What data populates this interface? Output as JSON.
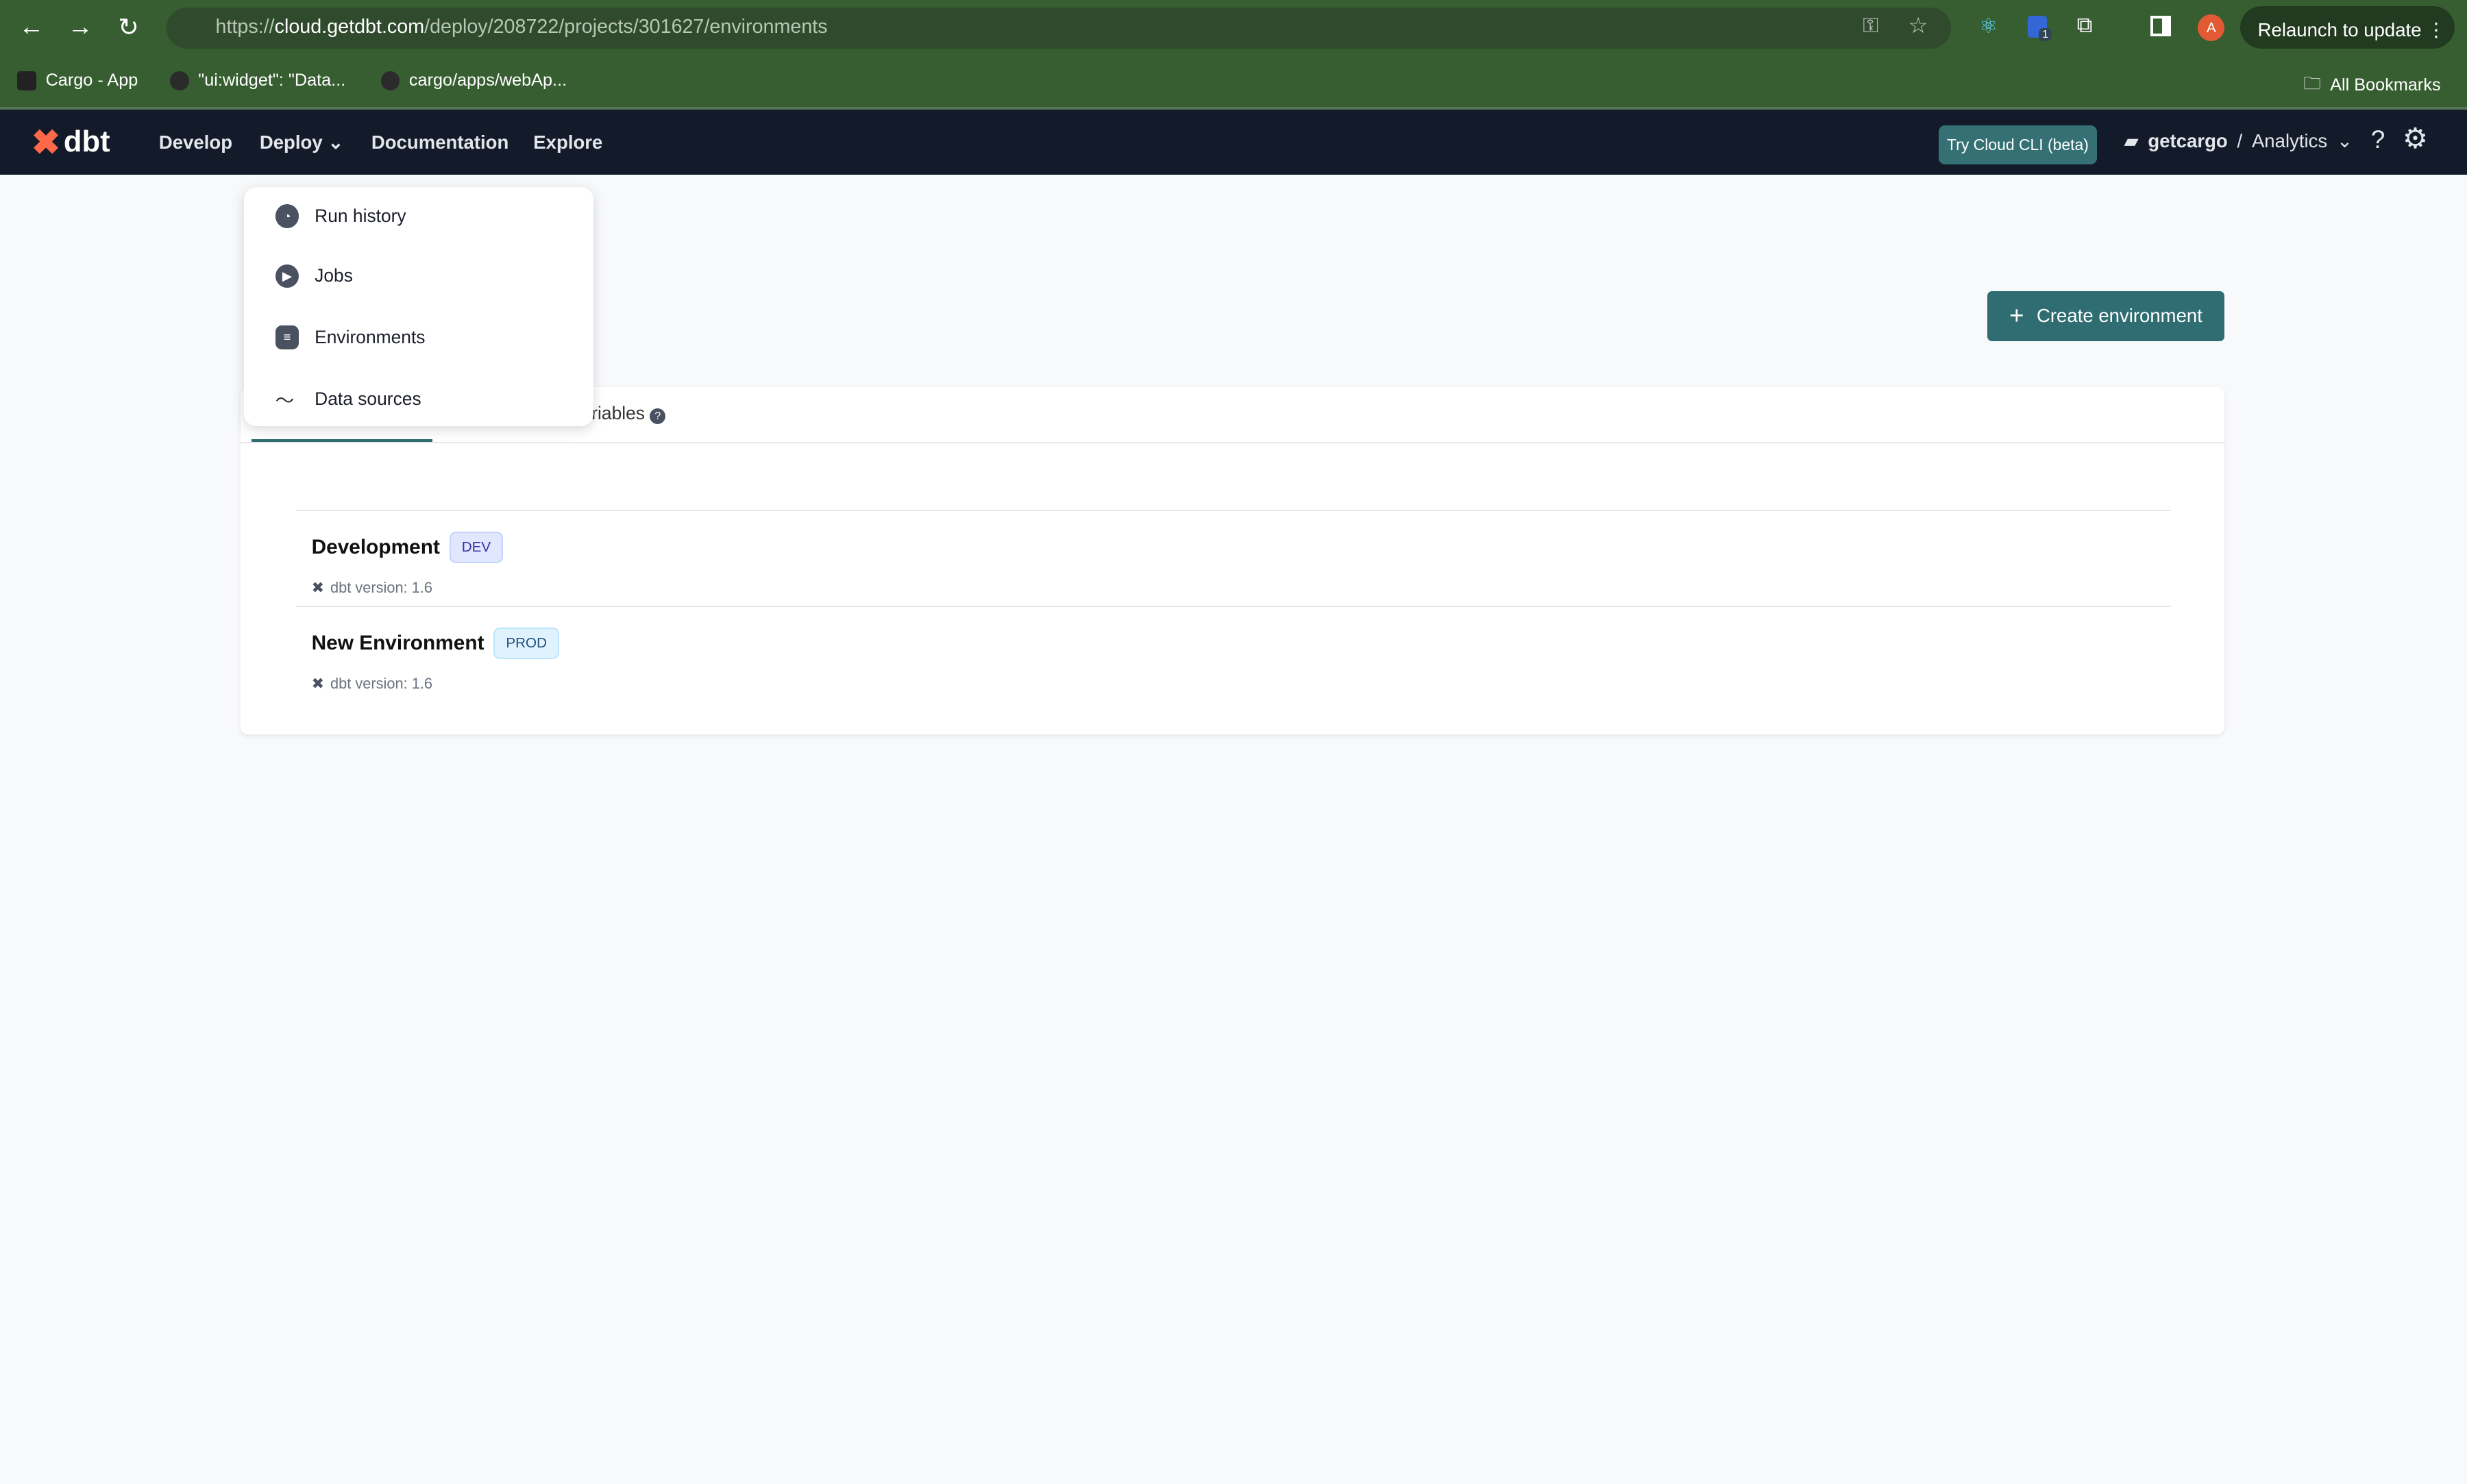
{
  "browser": {
    "url_prefix": "https://",
    "url_host": "cloud.getdbt.com",
    "url_path": "/deploy/208722/projects/301627/environments",
    "bookmarks": [
      "Cargo - App",
      "\"ui:widget\": \"Data...",
      "cargo/apps/webAp..."
    ],
    "all_bookmarks": "All Bookmarks",
    "relaunch": "Relaunch to update",
    "profile_initial": "A",
    "ext_badge": "1"
  },
  "nav": {
    "logo": "dbt",
    "items": [
      "Develop",
      "Deploy",
      "Documentation",
      "Explore"
    ],
    "try_cli": "Try Cloud CLI (beta)",
    "account": "getcargo",
    "separator": "/",
    "project": "Analytics"
  },
  "deploy_menu": [
    {
      "label": "Run history",
      "icon": "clock-icon"
    },
    {
      "label": "Jobs",
      "icon": "play-icon"
    },
    {
      "label": "Environments",
      "icon": "database-icon"
    },
    {
      "label": "Data sources",
      "icon": "activity-icon"
    }
  ],
  "page": {
    "create_button": "Create environment",
    "tab_partial": "riables",
    "environments": [
      {
        "name": "Development",
        "badge": "DEV",
        "version": "dbt version: 1.6"
      },
      {
        "name": "New Environment",
        "badge": "PROD",
        "version": "dbt version: 1.6"
      }
    ]
  },
  "colors": {
    "accent": "#2f6d72",
    "dev_badge": "#e0e7ff",
    "prod_badge": "#e0f2fe",
    "nav_bg": "#131a29"
  }
}
